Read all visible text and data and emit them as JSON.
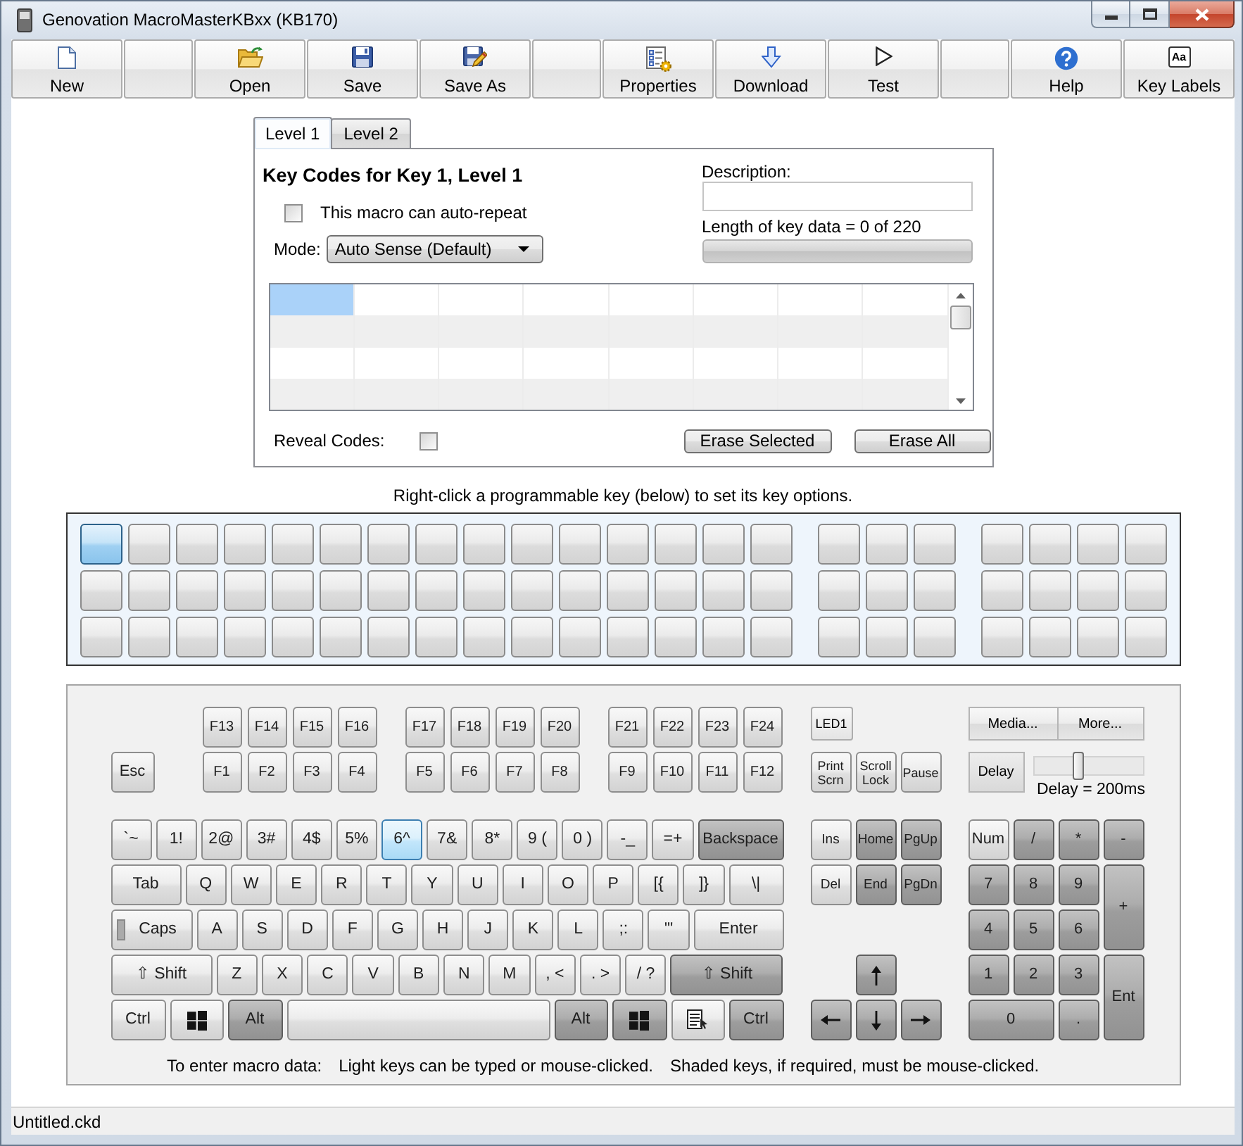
{
  "window": {
    "title": "Genovation MacroMasterKBxx (KB170)"
  },
  "toolbar": [
    {
      "kind": "button",
      "label": "New"
    },
    {
      "kind": "blank"
    },
    {
      "kind": "button",
      "label": "Open"
    },
    {
      "kind": "button",
      "label": "Save"
    },
    {
      "kind": "button",
      "label": "Save As"
    },
    {
      "kind": "blank"
    },
    {
      "kind": "button",
      "label": "Properties"
    },
    {
      "kind": "button",
      "label": "Download"
    },
    {
      "kind": "button",
      "label": "Test"
    },
    {
      "kind": "blank"
    },
    {
      "kind": "button",
      "label": "Help"
    },
    {
      "kind": "button",
      "label": "Key Labels",
      "glyph": "Aa"
    }
  ],
  "tabs": [
    {
      "label": "Level 1",
      "selected": true
    },
    {
      "label": "Level 2",
      "selected": false
    }
  ],
  "key_codes": {
    "heading": "Key Codes for Key 1, Level 1",
    "auto_repeat": {
      "label": "This macro can auto-repeat",
      "checked": false
    },
    "mode": {
      "label": "Mode:",
      "value": "Auto Sense (Default)"
    },
    "description": {
      "label": "Description:"
    },
    "length": {
      "label": "Length of key data = 0 of 220",
      "level": 0
    },
    "code_grid": {
      "rows": [
        {
          "cells": [
            {
              "selected": true
            },
            {
              "selected": false
            },
            {
              "selected": false
            },
            {
              "selected": false
            },
            {
              "selected": false
            },
            {
              "selected": false
            },
            {
              "selected": false
            },
            {
              "selected": false
            }
          ]
        },
        {
          "cells": [
            {
              "selected": false
            },
            {
              "selected": false
            },
            {
              "selected": false
            },
            {
              "selected": false
            },
            {
              "selected": false
            },
            {
              "selected": false
            },
            {
              "selected": false
            },
            {
              "selected": false
            }
          ]
        },
        {
          "cells": [
            {
              "selected": false
            },
            {
              "selected": false
            },
            {
              "selected": false
            },
            {
              "selected": false
            },
            {
              "selected": false
            },
            {
              "selected": false
            },
            {
              "selected": false
            },
            {
              "selected": false
            }
          ]
        },
        {
          "cells": [
            {
              "selected": false
            },
            {
              "selected": false
            },
            {
              "selected": false
            },
            {
              "selected": false
            },
            {
              "selected": false
            },
            {
              "selected": false
            },
            {
              "selected": false
            },
            {
              "selected": false
            }
          ]
        }
      ]
    },
    "reveal_codes": {
      "label": "Reveal Codes:",
      "checked": false
    },
    "buttons": [
      "Erase Selected",
      "Erase All"
    ]
  },
  "programmable_keys": {
    "hint": "Right-click a programmable key (below) to set its key options.",
    "rows": [
      {
        "groups": [
          {
            "keys": [
              {
                "selected": true
              },
              {
                "selected": false
              },
              {
                "selected": false
              },
              {
                "selected": false
              },
              {
                "selected": false
              },
              {
                "selected": false
              },
              {
                "selected": false
              },
              {
                "selected": false
              },
              {
                "selected": false
              },
              {
                "selected": false
              },
              {
                "selected": false
              },
              {
                "selected": false
              },
              {
                "selected": false
              },
              {
                "selected": false
              },
              {
                "selected": false
              }
            ]
          },
          {
            "keys": [
              {
                "selected": false
              },
              {
                "selected": false
              },
              {
                "selected": false
              }
            ]
          },
          {
            "keys": [
              {
                "selected": false
              },
              {
                "selected": false
              },
              {
                "selected": false
              },
              {
                "selected": false
              }
            ]
          }
        ]
      },
      {
        "groups": [
          {
            "keys": [
              {
                "selected": false
              },
              {
                "selected": false
              },
              {
                "selected": false
              },
              {
                "selected": false
              },
              {
                "selected": false
              },
              {
                "selected": false
              },
              {
                "selected": false
              },
              {
                "selected": false
              },
              {
                "selected": false
              },
              {
                "selected": false
              },
              {
                "selected": false
              },
              {
                "selected": false
              },
              {
                "selected": false
              },
              {
                "selected": false
              },
              {
                "selected": false
              }
            ]
          },
          {
            "keys": [
              {
                "selected": false
              },
              {
                "selected": false
              },
              {
                "selected": false
              }
            ]
          },
          {
            "keys": [
              {
                "selected": false
              },
              {
                "selected": false
              },
              {
                "selected": false
              },
              {
                "selected": false
              }
            ]
          }
        ]
      },
      {
        "groups": [
          {
            "keys": [
              {
                "selected": false
              },
              {
                "selected": false
              },
              {
                "selected": false
              },
              {
                "selected": false
              },
              {
                "selected": false
              },
              {
                "selected": false
              },
              {
                "selected": false
              },
              {
                "selected": false
              },
              {
                "selected": false
              },
              {
                "selected": false
              },
              {
                "selected": false
              },
              {
                "selected": false
              },
              {
                "selected": false
              },
              {
                "selected": false
              },
              {
                "selected": false
              }
            ]
          },
          {
            "keys": [
              {
                "selected": false
              },
              {
                "selected": false
              },
              {
                "selected": false
              }
            ]
          },
          {
            "keys": [
              {
                "selected": false
              },
              {
                "selected": false
              },
              {
                "selected": false
              },
              {
                "selected": false
              }
            ]
          }
        ]
      }
    ]
  },
  "keyboard": {
    "function_rows": [
      {
        "keys": [
          {
            "label": "F13",
            "shaded": false
          },
          {
            "label": "F14",
            "shaded": false
          },
          {
            "label": "F15",
            "shaded": false
          },
          {
            "label": "F16",
            "shaded": false
          },
          {
            "label": "F17",
            "shaded": false
          },
          {
            "label": "F18",
            "shaded": false
          },
          {
            "label": "F19",
            "shaded": false
          },
          {
            "label": "F20",
            "shaded": false
          },
          {
            "label": "F21",
            "shaded": false
          },
          {
            "label": "F22",
            "shaded": false
          },
          {
            "label": "F23",
            "shaded": false
          },
          {
            "label": "F24",
            "shaded": false
          }
        ]
      },
      {
        "keys": [
          {
            "label": "Esc",
            "shaded": false
          },
          {
            "label": "F1",
            "shaded": false
          },
          {
            "label": "F2",
            "shaded": false
          },
          {
            "label": "F3",
            "shaded": false
          },
          {
            "label": "F4",
            "shaded": false
          },
          {
            "label": "F5",
            "shaded": false
          },
          {
            "label": "F6",
            "shaded": false
          },
          {
            "label": "F7",
            "shaded": false
          },
          {
            "label": "F8",
            "shaded": false
          },
          {
            "label": "F9",
            "shaded": false
          },
          {
            "label": "F10",
            "shaded": false
          },
          {
            "label": "F11",
            "shaded": false
          },
          {
            "label": "F12",
            "shaded": false
          }
        ]
      }
    ],
    "led_button": "LED1",
    "system_keys": [
      {
        "label": "Print Scrn",
        "shaded": false
      },
      {
        "label": "Scroll Lock",
        "shaded": false
      },
      {
        "label": "Pause",
        "shaded": false
      }
    ],
    "option_buttons": [
      "Media...",
      "More..."
    ],
    "delay": {
      "button": "Delay",
      "level": 0.4,
      "reading": "Delay = 200ms"
    },
    "main_rows": [
      {
        "keys": [
          {
            "kind": "key",
            "label": "`~",
            "shaded": false,
            "highlighted": false
          },
          {
            "kind": "key",
            "label": "1!",
            "shaded": false,
            "highlighted": false
          },
          {
            "kind": "key",
            "label": "2@",
            "shaded": false,
            "highlighted": false
          },
          {
            "kind": "key",
            "label": "3#",
            "shaded": false,
            "highlighted": false
          },
          {
            "kind": "key",
            "label": "4$",
            "shaded": false,
            "highlighted": false
          },
          {
            "kind": "key",
            "label": "5%",
            "shaded": false,
            "highlighted": false
          },
          {
            "kind": "key",
            "label": "6^",
            "shaded": false,
            "highlighted": true
          },
          {
            "kind": "key",
            "label": "7&",
            "shaded": false,
            "highlighted": false
          },
          {
            "kind": "key",
            "label": "8*",
            "shaded": false,
            "highlighted": false
          },
          {
            "kind": "key",
            "label": "9 (",
            "shaded": false,
            "highlighted": false
          },
          {
            "kind": "key",
            "label": "0 )",
            "shaded": false,
            "highlighted": false
          },
          {
            "kind": "key",
            "label": "-_",
            "shaded": false,
            "highlighted": false
          },
          {
            "kind": "key",
            "label": "=+",
            "shaded": false,
            "highlighted": false
          },
          {
            "kind": "key",
            "label": "Backspace",
            "shaded": true,
            "highlighted": false
          }
        ]
      },
      {
        "keys": [
          {
            "kind": "key",
            "label": "Tab",
            "shaded": false,
            "highlighted": false
          },
          {
            "kind": "key",
            "label": "Q",
            "shaded": false,
            "highlighted": false
          },
          {
            "kind": "key",
            "label": "W",
            "shaded": false,
            "highlighted": false
          },
          {
            "kind": "key",
            "label": "E",
            "shaded": false,
            "highlighted": false
          },
          {
            "kind": "key",
            "label": "R",
            "shaded": false,
            "highlighted": false
          },
          {
            "kind": "key",
            "label": "T",
            "shaded": false,
            "highlighted": false
          },
          {
            "kind": "key",
            "label": "Y",
            "shaded": false,
            "highlighted": false
          },
          {
            "kind": "key",
            "label": "U",
            "shaded": false,
            "highlighted": false
          },
          {
            "kind": "key",
            "label": "I",
            "shaded": false,
            "highlighted": false
          },
          {
            "kind": "key",
            "label": "O",
            "shaded": false,
            "highlighted": false
          },
          {
            "kind": "key",
            "label": "P",
            "shaded": false,
            "highlighted": false
          },
          {
            "kind": "key",
            "label": "[{",
            "shaded": false,
            "highlighted": false
          },
          {
            "kind": "key",
            "label": "]}",
            "shaded": false,
            "highlighted": false
          },
          {
            "kind": "key",
            "label": "\\|",
            "shaded": false,
            "highlighted": false
          }
        ]
      },
      {
        "keys": [
          {
            "kind": "caps",
            "label": "Caps",
            "shaded": false,
            "highlighted": false
          },
          {
            "kind": "key",
            "label": "A",
            "shaded": false,
            "highlighted": false
          },
          {
            "kind": "key",
            "label": "S",
            "shaded": false,
            "highlighted": false
          },
          {
            "kind": "key",
            "label": "D",
            "shaded": false,
            "highlighted": false
          },
          {
            "kind": "key",
            "label": "F",
            "shaded": false,
            "highlighted": false
          },
          {
            "kind": "key",
            "label": "G",
            "shaded": false,
            "highlighted": false
          },
          {
            "kind": "key",
            "label": "H",
            "shaded": false,
            "highlighted": false
          },
          {
            "kind": "key",
            "label": "J",
            "shaded": false,
            "highlighted": false
          },
          {
            "kind": "key",
            "label": "K",
            "shaded": false,
            "highlighted": false
          },
          {
            "kind": "key",
            "label": "L",
            "shaded": false,
            "highlighted": false
          },
          {
            "kind": "key",
            "label": ";:",
            "shaded": false,
            "highlighted": false
          },
          {
            "kind": "key",
            "label": "'\"",
            "shaded": false,
            "highlighted": false
          },
          {
            "kind": "key",
            "label": "Enter",
            "shaded": false,
            "highlighted": false
          }
        ]
      },
      {
        "keys": [
          {
            "kind": "key",
            "label": "⇧ Shift",
            "shaded": false,
            "highlighted": false
          },
          {
            "kind": "key",
            "label": "Z",
            "shaded": false,
            "highlighted": false
          },
          {
            "kind": "key",
            "label": "X",
            "shaded": false,
            "highlighted": false
          },
          {
            "kind": "key",
            "label": "C",
            "shaded": false,
            "highlighted": false
          },
          {
            "kind": "key",
            "label": "V",
            "shaded": false,
            "highlighted": false
          },
          {
            "kind": "key",
            "label": "B",
            "shaded": false,
            "highlighted": false
          },
          {
            "kind": "key",
            "label": "N",
            "shaded": false,
            "highlighted": false
          },
          {
            "kind": "key",
            "label": "M",
            "shaded": false,
            "highlighted": false
          },
          {
            "kind": "key",
            "label": ", <",
            "shaded": false,
            "highlighted": false
          },
          {
            "kind": "key",
            "label": ". >",
            "shaded": false,
            "highlighted": false
          },
          {
            "kind": "key",
            "label": "/ ?",
            "shaded": false,
            "highlighted": false
          },
          {
            "kind": "key",
            "label": "⇧ Shift",
            "shaded": true,
            "highlighted": false
          }
        ]
      },
      {
        "keys": [
          {
            "kind": "key",
            "label": "Ctrl",
            "shaded": false,
            "highlighted": false
          },
          {
            "kind": "windows",
            "shaded": false,
            "highlighted": false
          },
          {
            "kind": "key",
            "label": "Alt",
            "shaded": true,
            "highlighted": false
          },
          {
            "kind": "space",
            "shaded": false,
            "highlighted": false
          },
          {
            "kind": "key",
            "label": "Alt",
            "shaded": true,
            "highlighted": false
          },
          {
            "kind": "windows",
            "shaded": true,
            "highlighted": false
          },
          {
            "kind": "menu",
            "shaded": false,
            "highlighted": false
          },
          {
            "kind": "key",
            "label": "Ctrl",
            "shaded": true,
            "highlighted": false
          }
        ]
      }
    ],
    "nav_keys": [
      {
        "kind": "key",
        "label": "Ins",
        "shaded": false
      },
      {
        "kind": "key",
        "label": "Home",
        "shaded": true
      },
      {
        "kind": "key",
        "label": "PgUp",
        "shaded": true
      },
      {
        "kind": "key",
        "label": "Del",
        "shaded": false
      },
      {
        "kind": "key",
        "label": "End",
        "shaded": true
      },
      {
        "kind": "key",
        "label": "PgDn",
        "shaded": true
      },
      {
        "kind": "arrow-up",
        "shaded": true
      },
      {
        "kind": "arrow-left",
        "shaded": true
      },
      {
        "kind": "arrow-down",
        "shaded": true
      },
      {
        "kind": "arrow-right",
        "shaded": true
      }
    ],
    "numpad": [
      {
        "label": "Num",
        "shaded": false
      },
      {
        "label": "/",
        "shaded": true
      },
      {
        "label": "*",
        "shaded": true
      },
      {
        "label": "-",
        "shaded": true
      },
      {
        "label": "7",
        "shaded": true
      },
      {
        "label": "8",
        "shaded": true
      },
      {
        "label": "9",
        "shaded": true
      },
      {
        "label": "+",
        "shaded": true
      },
      {
        "label": "4",
        "shaded": true
      },
      {
        "label": "5",
        "shaded": true
      },
      {
        "label": "6",
        "shaded": true
      },
      {
        "label": "1",
        "shaded": true
      },
      {
        "label": "2",
        "shaded": true
      },
      {
        "label": "3",
        "shaded": true
      },
      {
        "label": "Ent",
        "shaded": true
      },
      {
        "label": "0",
        "shaded": true
      },
      {
        "label": ".",
        "shaded": true
      }
    ],
    "legend": [
      "To enter macro data:",
      "Light keys can be typed or mouse-clicked.",
      "Shaded keys, if required, must be mouse-clicked."
    ]
  },
  "status_bar": {
    "text": "Untitled.ckd"
  }
}
